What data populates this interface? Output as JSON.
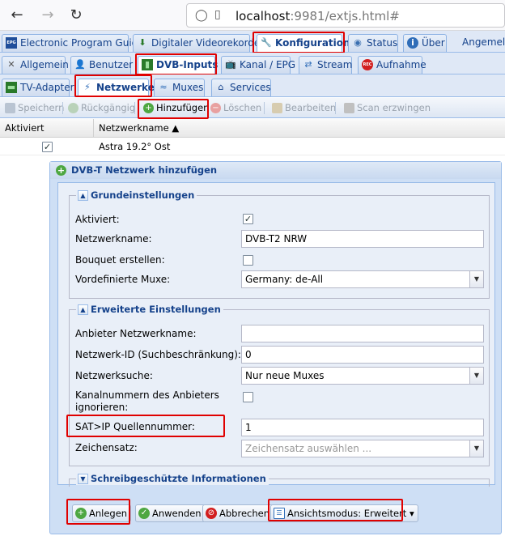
{
  "browser": {
    "back_icon": "←",
    "forward_icon": "→",
    "reload_icon": "↻",
    "shield_icon": "◯",
    "page_icon": "▯",
    "url_host": "localhost",
    "url_path": ":9981/extjs.html#"
  },
  "top_tabs": [
    {
      "label": "Electronic Program Guide",
      "icon": "EPG"
    },
    {
      "label": "Digitaler Videorekorder",
      "icon": "⬇"
    },
    {
      "label": "Konfiguration",
      "icon": "🔧"
    },
    {
      "label": "Status",
      "icon": "◉"
    },
    {
      "label": "Über",
      "icon": "i"
    },
    {
      "label": "Angemelde",
      "icon": ""
    }
  ],
  "config_tabs": [
    {
      "label": "Allgemein",
      "icon": "✕"
    },
    {
      "label": "Benutzer",
      "icon": "👤"
    },
    {
      "label": "DVB-Inputs",
      "icon": "▮"
    },
    {
      "label": "Kanal / EPG",
      "icon": "📺"
    },
    {
      "label": "Stream",
      "icon": "⇄"
    },
    {
      "label": "Aufnahme",
      "icon": "REC"
    }
  ],
  "dvb_tabs": [
    {
      "label": "TV-Adapter",
      "icon": "▬"
    },
    {
      "label": "Netzwerke",
      "icon": "⚡"
    },
    {
      "label": "Muxes",
      "icon": "≈"
    },
    {
      "label": "Services",
      "icon": "⌂"
    }
  ],
  "toolbar": {
    "save": "Speichern",
    "undo": "Rückgängig",
    "add": "Hinzufügen",
    "delete": "Löschen",
    "edit": "Bearbeiten",
    "scan": "Scan erzwingen"
  },
  "grid": {
    "columns": [
      "Aktiviert",
      "Netzwerkname ▲"
    ],
    "rows": [
      {
        "activated": "✓",
        "name": "Astra 19.2° Ost"
      }
    ]
  },
  "dialog": {
    "title": "DVB-T Netzwerk hinzufügen",
    "basic": {
      "legend": "Grundeinstellungen",
      "activated_label": "Aktiviert:",
      "activated_check": "✓",
      "name_label": "Netzwerkname:",
      "name_value": "DVB-T2 NRW",
      "bouquet_label": "Bouquet erstellen:",
      "muxes_label": "Vordefinierte Muxe:",
      "muxes_value": "Germany: de-All"
    },
    "advanced": {
      "legend": "Erweiterte Einstellungen",
      "provider_label": "Anbieter Netzwerkname:",
      "provider_value": "",
      "netid_label": "Netzwerk-ID (Suchbeschränkung):",
      "netid_value": "0",
      "search_label": "Netzwerksuche:",
      "search_value": "Nur neue Muxes",
      "ignore_label_1": "Kanalnummern des Anbieters",
      "ignore_label_2": "ignorieren:",
      "satip_label": "SAT>IP Quellennummer:",
      "satip_value": "1",
      "charset_label": "Zeichensatz:",
      "charset_placeholder": "Zeichensatz auswählen ..."
    },
    "readonly": {
      "legend": "Schreibgeschützte Informationen"
    },
    "buttons": {
      "create": "Anlegen",
      "apply": "Anwenden",
      "cancel": "Abbrechen",
      "viewmode": "Ansichtsmodus: Erweitert ▾"
    }
  }
}
